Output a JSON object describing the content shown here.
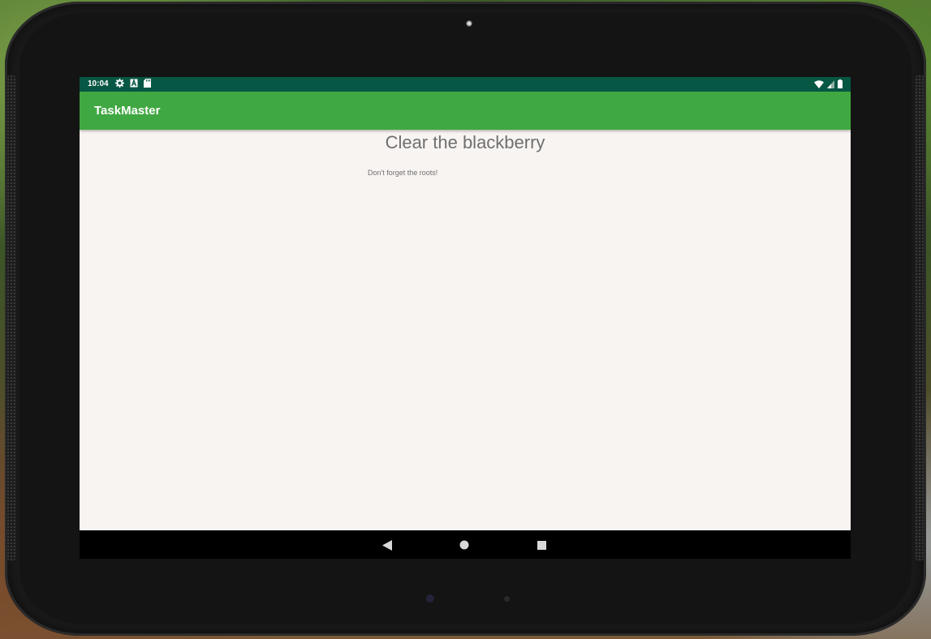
{
  "status_bar": {
    "time": "10:04",
    "left_icons": [
      "gear-icon",
      "font-a-icon",
      "sd-card-icon"
    ],
    "right_icons": [
      "wifi-icon",
      "signal-icon",
      "battery-icon"
    ]
  },
  "app_bar": {
    "title": "TaskMaster"
  },
  "task": {
    "title": "Clear the blackberry",
    "description": "Don't forget the roots!"
  },
  "nav_bar": {
    "buttons": [
      "back-icon",
      "home-icon",
      "recents-icon"
    ]
  },
  "colors": {
    "status_bar": "#065744",
    "app_bar": "#40a842",
    "screen_bg": "#f8f4f2",
    "text_gray": "#6f6f6f"
  }
}
